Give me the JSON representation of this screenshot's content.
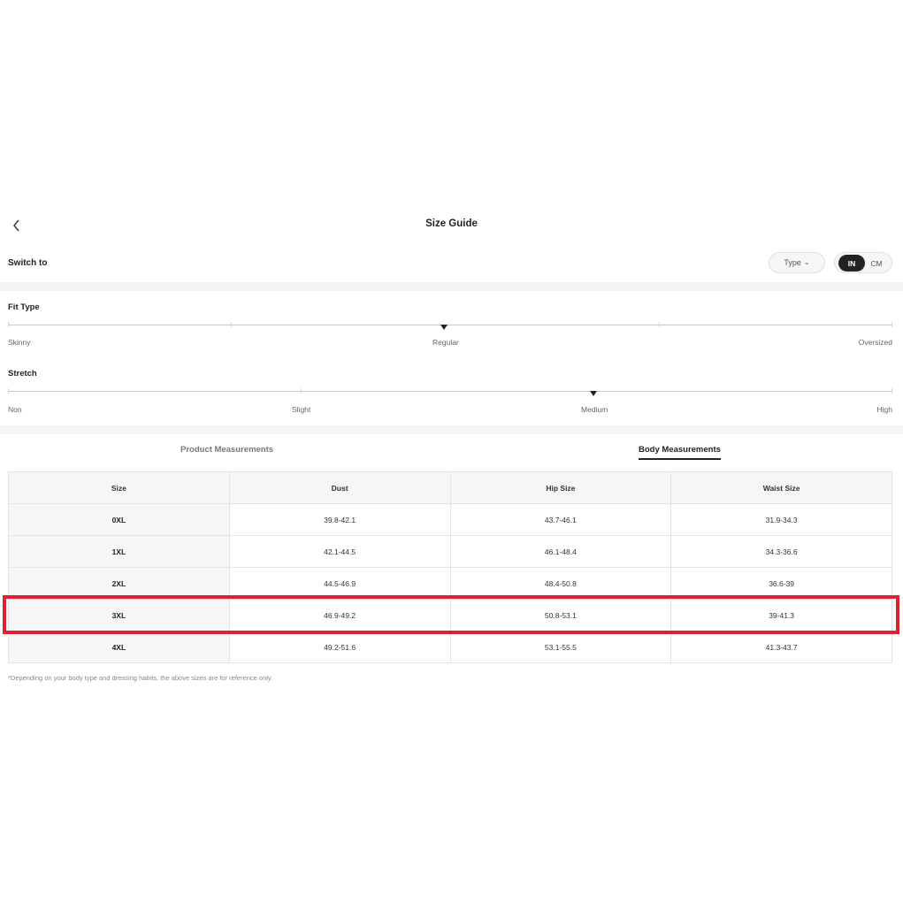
{
  "header": {
    "title": "Size Guide"
  },
  "switch_row": {
    "label": "Switch to",
    "type_button": "Type",
    "units": [
      "IN",
      "CM"
    ],
    "active_unit": "IN"
  },
  "fit_type": {
    "label": "Fit Type",
    "options": [
      "Skinny",
      "Regular",
      "Oversized"
    ],
    "selected": "Regular"
  },
  "stretch": {
    "label": "Stretch",
    "options": [
      "Non",
      "Slight",
      "Medium",
      "High"
    ],
    "selected": "Medium"
  },
  "tabs": [
    {
      "label": "Product Measurements",
      "active": false
    },
    {
      "label": "Body Measurements",
      "active": true
    }
  ],
  "table": {
    "headers": [
      "Size",
      "Dust",
      "Hip Size",
      "Waist Size"
    ],
    "rows": [
      [
        "0XL",
        "39.8-42.1",
        "43.7-46.1",
        "31.9-34.3"
      ],
      [
        "1XL",
        "42.1-44.5",
        "46.1-48.4",
        "34.3-36.6"
      ],
      [
        "2XL",
        "44.5-46.9",
        "48.4-50.8",
        "36.6-39"
      ],
      [
        "3XL",
        "46.9-49.2",
        "50.8-53.1",
        "39-41.3"
      ],
      [
        "4XL",
        "49.2-51.6",
        "53.1-55.5",
        "41.3-43.7"
      ]
    ],
    "highlighted_row": "3XL"
  },
  "footnote": "*Depending on your body type and dressing habits, the above sizes are for reference only.",
  "colors": {
    "accent": "#222222",
    "highlight": "#d9232e",
    "band": "#f4f4f4"
  },
  "icons": {
    "back": "chevron-left-icon",
    "type_dropdown": "chevron-down-icon",
    "scale_marker": "triangle-down-icon"
  }
}
